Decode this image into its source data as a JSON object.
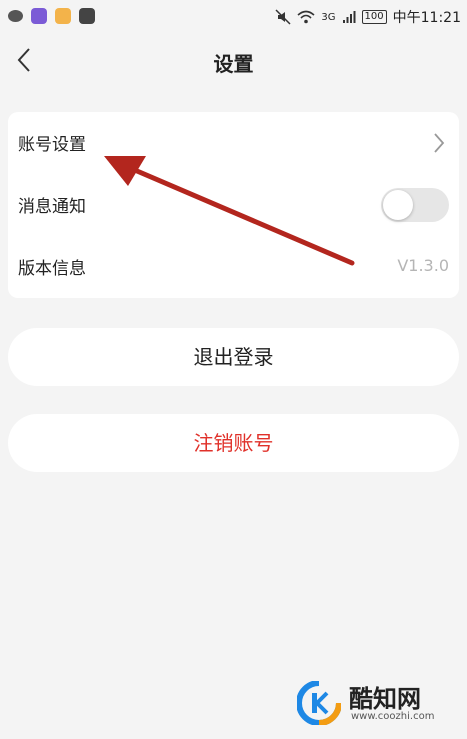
{
  "status_bar": {
    "time": "中午11:21",
    "battery": "100",
    "network": "3G"
  },
  "header": {
    "title": "设置",
    "back_icon": "chevron-left-icon"
  },
  "settings": {
    "items": [
      {
        "label": "账号设置",
        "icon": "chevron-right-icon"
      },
      {
        "label": "消息通知",
        "toggle_on": false
      },
      {
        "label": "版本信息",
        "value": "V1.3.0"
      }
    ]
  },
  "buttons": {
    "logout_label": "退出登录",
    "delete_label": "注销账号"
  },
  "colors": {
    "accent_red": "#e0312a",
    "arrow_red": "#b3261e",
    "background": "#f4f4f4"
  },
  "watermark": {
    "name": "酷知网",
    "url": "www.coozhi.com"
  }
}
